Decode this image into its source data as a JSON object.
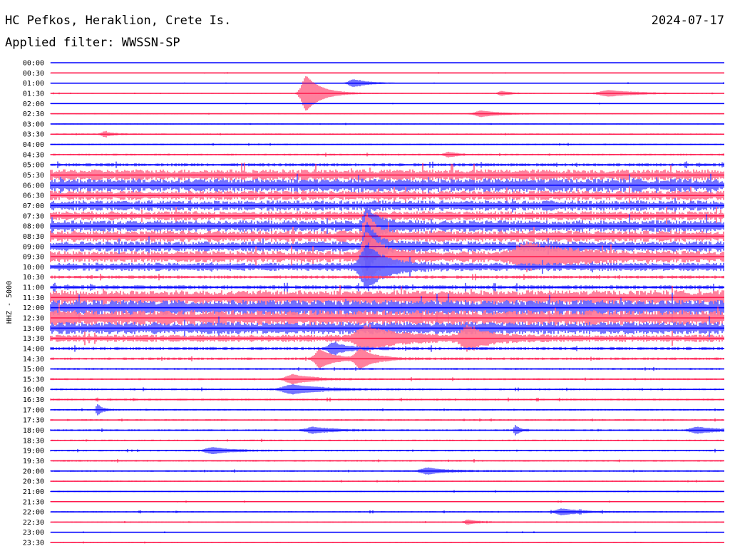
{
  "header": {
    "station": "HC Pefkos, Heraklion, Crete Is.",
    "date": "2024-07-17",
    "filter_label": "Applied filter:",
    "filter_value": "WWSSN-SP"
  },
  "chart_data": {
    "type": "line",
    "ylabel": "HHZ - 5000",
    "colors": [
      "#0000ff",
      "#ff1a4d"
    ],
    "row_labels": [
      "00:00",
      "00:30",
      "01:00",
      "01:30",
      "02:00",
      "02:30",
      "03:00",
      "03:30",
      "04:00",
      "04:30",
      "05:00",
      "05:30",
      "06:00",
      "06:30",
      "07:00",
      "07:30",
      "08:00",
      "08:30",
      "09:00",
      "09:30",
      "10:00",
      "10:30",
      "11:00",
      "11:30",
      "12:00",
      "12:30",
      "13:00",
      "13:30",
      "14:00",
      "14:30",
      "15:00",
      "15:30",
      "16:00",
      "16:30",
      "17:00",
      "17:30",
      "18:00",
      "18:30",
      "19:00",
      "19:30",
      "20:00",
      "20:30",
      "21:00",
      "21:30",
      "22:00",
      "22:30",
      "23:00",
      "23:30"
    ],
    "noise_level": [
      0.3,
      0.35,
      0.4,
      0.45,
      0.4,
      0.45,
      0.5,
      0.7,
      0.7,
      0.9,
      1.5,
      5.5,
      6.5,
      4.5,
      5,
      4.5,
      5.5,
      5.5,
      5,
      5.5,
      4,
      1.5,
      2,
      7,
      7.5,
      7.5,
      6,
      3.5,
      1.5,
      1.2,
      0.9,
      0.9,
      0.9,
      0.9,
      0.8,
      0.8,
      0.9,
      0.8,
      0.8,
      0.8,
      0.8,
      0.6,
      0.6,
      0.5,
      0.7,
      0.6,
      0.5,
      0.5
    ],
    "events": [
      {
        "row": 2,
        "x": 0.45,
        "amp": 5,
        "w": 0.015
      },
      {
        "row": 3,
        "x": 0.38,
        "amp": 24,
        "w": 0.015
      },
      {
        "row": 3,
        "x": 0.83,
        "amp": 4,
        "w": 0.03
      },
      {
        "row": 3,
        "x": 0.67,
        "amp": 3,
        "w": 0.01
      },
      {
        "row": 5,
        "x": 0.64,
        "amp": 4,
        "w": 0.02
      },
      {
        "row": 7,
        "x": 0.08,
        "amp": 3,
        "w": 0.01
      },
      {
        "row": 9,
        "x": 0.59,
        "amp": 3,
        "w": 0.01
      },
      {
        "row": 16,
        "x": 0.47,
        "amp": 22,
        "w": 0.01
      },
      {
        "row": 17,
        "x": 0.47,
        "amp": 26,
        "w": 0.01
      },
      {
        "row": 18,
        "x": 0.47,
        "amp": 30,
        "w": 0.01
      },
      {
        "row": 19,
        "x": 0.47,
        "amp": 32,
        "w": 0.015
      },
      {
        "row": 20,
        "x": 0.47,
        "amp": 26,
        "w": 0.02
      },
      {
        "row": 19,
        "x": 0.71,
        "amp": 14,
        "w": 0.04
      },
      {
        "row": 27,
        "x": 0.47,
        "amp": 14,
        "w": 0.03
      },
      {
        "row": 27,
        "x": 0.62,
        "amp": 14,
        "w": 0.02
      },
      {
        "row": 28,
        "x": 0.42,
        "amp": 7,
        "w": 0.015
      },
      {
        "row": 29,
        "x": 0.4,
        "amp": 12,
        "w": 0.015
      },
      {
        "row": 29,
        "x": 0.46,
        "amp": 12,
        "w": 0.015
      },
      {
        "row": 31,
        "x": 0.36,
        "amp": 6,
        "w": 0.02
      },
      {
        "row": 32,
        "x": 0.36,
        "amp": 6,
        "w": 0.03
      },
      {
        "row": 34,
        "x": 0.07,
        "amp": 7,
        "w": 0.005
      },
      {
        "row": 36,
        "x": 0.39,
        "amp": 4,
        "w": 0.02
      },
      {
        "row": 36,
        "x": 0.69,
        "amp": 6,
        "w": 0.005
      },
      {
        "row": 36,
        "x": 0.96,
        "amp": 4,
        "w": 0.02
      },
      {
        "row": 38,
        "x": 0.24,
        "amp": 4,
        "w": 0.02
      },
      {
        "row": 40,
        "x": 0.56,
        "amp": 4,
        "w": 0.02
      },
      {
        "row": 44,
        "x": 0.76,
        "amp": 4,
        "w": 0.02
      },
      {
        "row": 45,
        "x": 0.62,
        "amp": 3,
        "w": 0.01
      }
    ]
  }
}
